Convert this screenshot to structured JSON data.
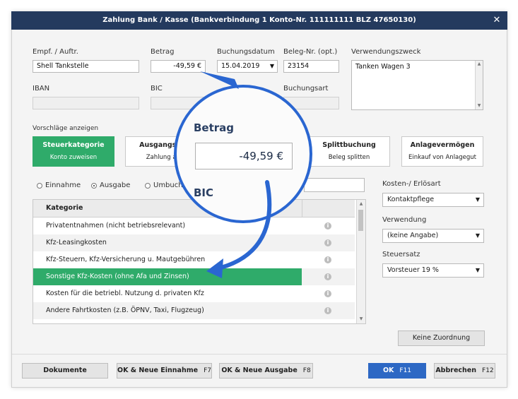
{
  "window": {
    "title": "Zahlung Bank / Kasse (Bankverbindung 1 Konto-Nr. 111111111  BLZ 47650130)"
  },
  "fields": {
    "empf_label": "Empf. / Auftr.",
    "empf_value": "Shell Tankstelle",
    "betrag_label": "Betrag",
    "betrag_value": "-49,59 €",
    "buchungsdatum_label": "Buchungsdatum",
    "buchungsdatum_value": "15.04.2019",
    "belegnr_label": "Beleg-Nr. (opt.)",
    "belegnr_value": "23154",
    "verwendungszweck_label": "Verwendungszweck",
    "verwendungszweck_value": "Tanken Wagen 3",
    "iban_label": "IBAN",
    "bic_label": "BIC",
    "buchungsart_label": "Buchungsart"
  },
  "suggestions": {
    "label": "Vorschläge anzeigen",
    "items": [
      {
        "title": "Steuerkategorie",
        "sub": "Konto zuweisen"
      },
      {
        "title": "Ausgangsrech",
        "sub": "Zahlung an K"
      },
      {
        "title": "Splittbuchung",
        "sub": "Beleg splitten"
      },
      {
        "title": "Anlagevermögen",
        "sub": "Einkauf von Anlagegut"
      }
    ]
  },
  "radios": {
    "einnahme": "Einnahme",
    "ausgabe": "Ausgabe",
    "umbuchung": "Umbuch"
  },
  "table": {
    "header": "Kategorie",
    "rows": [
      "Privatentnahmen  (nicht betriebsrelevant)",
      "Kfz-Leasingkosten",
      "Kfz-Steuern, Kfz-Versicherung u. Mautgebühren",
      "Sonstige Kfz-Kosten (ohne Afa und Zinsen)",
      "Kosten für die betriebl. Nutzung d. privaten Kfz",
      "Andere Fahrtkosten (z.B. ÖPNV, Taxi, Flugzeug)"
    ]
  },
  "right_panel": {
    "kostenart_label": "Kosten-/ Erlösart",
    "kostenart_value": "Kontaktpflege",
    "verwendung_label": "Verwendung",
    "verwendung_value": "(keine Angabe)",
    "steuersatz_label": "Steuersatz",
    "steuersatz_value": "Vorsteuer 19 %",
    "keine_zuordnung": "Keine Zuordnung"
  },
  "footer": {
    "dokumente": "Dokumente",
    "ok_einnahme": "OK & Neue Einnahme",
    "ok_einnahme_key": "F7",
    "ok_ausgabe": "OK & Neue Ausgabe",
    "ok_ausgabe_key": "F8",
    "ok": "OK",
    "ok_key": "F11",
    "abbrechen": "Abbrechen",
    "abbrechen_key": "F12"
  },
  "magnifier": {
    "label": "Betrag",
    "value": "-49,59 €",
    "sub_label": "BIC"
  },
  "colors": {
    "titlebar": "#243a5e",
    "accent_green": "#2fab6a",
    "primary_blue": "#2d68c4",
    "magnifier_ring": "#2a66d1"
  }
}
